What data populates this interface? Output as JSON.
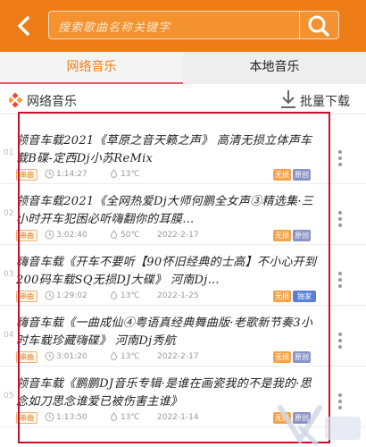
{
  "header": {
    "search_placeholder": "搜索歌曲名称关键字"
  },
  "tabs": [
    {
      "label": "网络音乐",
      "active": true
    },
    {
      "label": "本地音乐",
      "active": false
    }
  ],
  "section": {
    "title": "网络音乐",
    "batch_download_label": "批量下载"
  },
  "songs": [
    {
      "edge": "01",
      "title": "领音车载2021《草原之音天籁之声》 高清无损立体声车载B碟-定西Dj小苏ReMix",
      "source": "串曲",
      "duration": "1:14:27",
      "temp": "13℃",
      "date": "",
      "quality": "无损",
      "tag": "原创"
    },
    {
      "edge": "02",
      "title": "领音车载2021《全网热爱Dj大师何鹏全女声③精选集·三小时开车犯困必听嗨翻你的耳膜…",
      "source": "串曲",
      "duration": "3:02:40",
      "temp": "50℃",
      "date": "2022-2-17",
      "quality": "无损",
      "tag": "原创"
    },
    {
      "edge": "03",
      "title": "嗨音车载《开车不要听【90怀旧经典的士高】不小心开到200码车载SQ无损DJ大碟》 河南Dj…",
      "source": "串曲",
      "duration": "1:29:02",
      "temp": "13℃",
      "date": "2022-1-25",
      "quality": "无损",
      "tag": "独家"
    },
    {
      "edge": "04",
      "title": "嗨音车载《一曲成仙④粤语真经典舞曲版·老歌新节奏3小时车载珍藏嗨碟》 河南Dj秀航",
      "source": "串曲",
      "duration": "3:01:20",
      "temp": "13℃",
      "date": "2022-2-17",
      "quality": "无损",
      "tag": "原创"
    },
    {
      "edge": "05",
      "title": "领音车载《鹏鹏DJ音乐专辑·是谁在画瓷我的不是我的·思念如刀思念谁爱已被伤害主谁》",
      "source": "串曲",
      "duration": "1:13:50",
      "temp": "13℃",
      "date": "2022-1-14",
      "quality": "无损",
      "tag": "原创"
    }
  ],
  "colors": {
    "accent": "#ef7d17",
    "highlight": "#c8102e",
    "tab_underline": "#e85a66"
  }
}
